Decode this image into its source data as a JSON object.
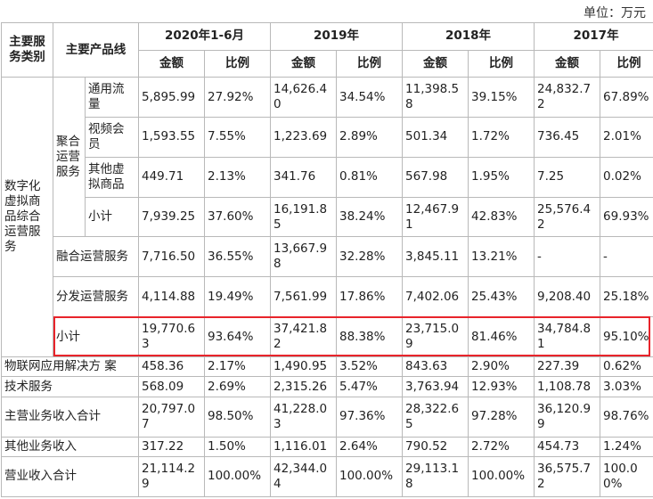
{
  "unit_label": "单位：万元",
  "header": {
    "col_category": "主要服务类别",
    "col_product": "主要产品线",
    "periods": [
      "2020年1-6月",
      "2019年",
      "2018年",
      "2017年"
    ],
    "amount": "金额",
    "ratio": "比例"
  },
  "category_digital": "数字化虚拟商品综合运营服务",
  "group_aggregate": "聚合运营服务",
  "rows": {
    "traffic": {
      "label": "通用流量",
      "v": [
        "5,895.99",
        "27.92%",
        "14,626.40",
        "34.54%",
        "11,398.58",
        "39.15%",
        "24,832.72",
        "67.89%"
      ]
    },
    "video": {
      "label": "视频会员",
      "v": [
        "1,593.55",
        "7.55%",
        "1,223.69",
        "2.89%",
        "501.34",
        "1.72%",
        "736.45",
        "2.01%"
      ]
    },
    "other_virtual": {
      "label": "其他虚拟商品",
      "v": [
        "449.71",
        "2.13%",
        "341.76",
        "0.81%",
        "567.98",
        "1.95%",
        "7.25",
        "0.02%"
      ]
    },
    "agg_subtotal": {
      "label": "小计",
      "v": [
        "7,939.25",
        "37.60%",
        "16,191.85",
        "38.24%",
        "12,467.91",
        "42.83%",
        "25,576.42",
        "69.93%"
      ]
    },
    "fusion": {
      "label": "融合运营服务",
      "v": [
        "7,716.50",
        "36.55%",
        "13,667.98",
        "32.28%",
        "3,845.11",
        "13.21%",
        "-",
        "-"
      ]
    },
    "distribution": {
      "label": "分发运营服务",
      "v": [
        "4,114.88",
        "19.49%",
        "7,561.99",
        "17.86%",
        "7,402.06",
        "25.43%",
        "9,208.40",
        "25.18%"
      ]
    },
    "digital_subtotal": {
      "label": "小计",
      "v": [
        "19,770.63",
        "93.64%",
        "37,421.82",
        "88.38%",
        "23,715.09",
        "81.46%",
        "34,784.81",
        "95.10%"
      ]
    },
    "iot": {
      "label": "物联网应用解决方 案",
      "v": [
        "458.36",
        "2.17%",
        "1,490.95",
        "3.52%",
        "843.63",
        "2.90%",
        "227.39",
        "0.62%"
      ]
    },
    "tech": {
      "label": "技术服务",
      "v": [
        "568.09",
        "2.69%",
        "2,315.26",
        "5.47%",
        "3,763.94",
        "12.93%",
        "1,108.78",
        "3.03%"
      ]
    },
    "main_total": {
      "label": "主营业务收入合计",
      "v": [
        "20,797.07",
        "98.50%",
        "41,228.03",
        "97.36%",
        "28,322.65",
        "97.28%",
        "36,120.99",
        "98.76%"
      ]
    },
    "other_business": {
      "label": "其他业务收入",
      "v": [
        "317.22",
        "1.50%",
        "1,116.01",
        "2.64%",
        "790.52",
        "2.72%",
        "454.73",
        "1.24%"
      ]
    },
    "revenue_total": {
      "label": "营业收入合计",
      "v": [
        "21,114.29",
        "100.00%",
        "42,344.04",
        "100.00%",
        "29,113.18",
        "100.00%",
        "36,575.72",
        "100.00%"
      ]
    }
  },
  "highlight_color": "#e8242b"
}
